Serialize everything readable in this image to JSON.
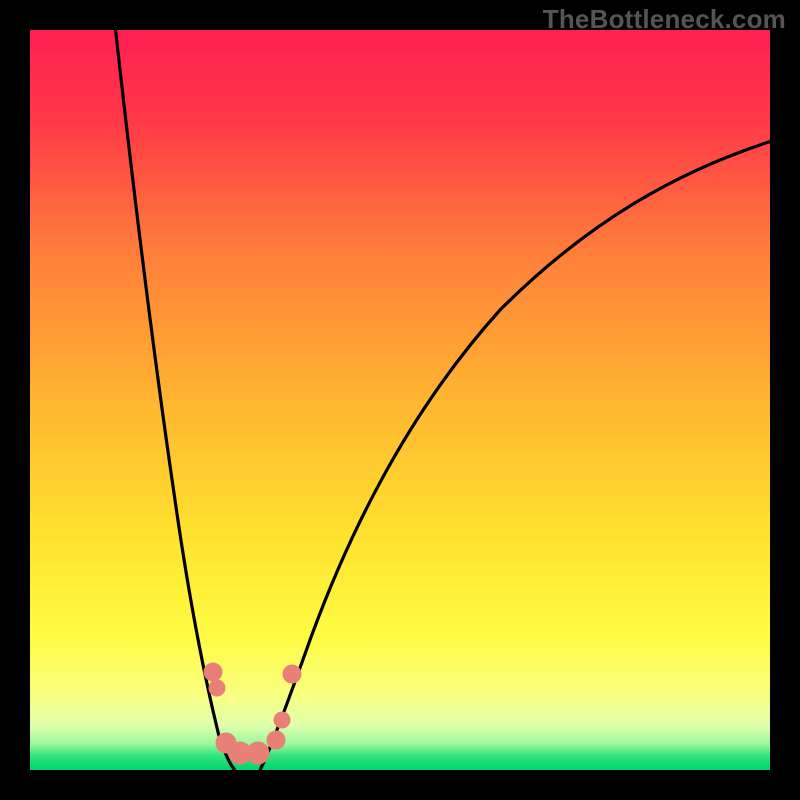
{
  "watermark": "TheBottleneck.com",
  "colors": {
    "frame": "#000000",
    "gradient_top": "#ff1f52",
    "gradient_mid": "#ffe12e",
    "gradient_bottom": "#00d56e",
    "curve": "#000000",
    "markers": "#e98077"
  },
  "chart_data": {
    "type": "line",
    "title": "",
    "xlabel": "",
    "ylabel": "",
    "xlim": [
      0,
      100
    ],
    "ylim": [
      0,
      100
    ],
    "grid": false,
    "legend": false,
    "annotations": [
      "TheBottleneck.com"
    ],
    "background_gradient": {
      "direction": "vertical",
      "stops": [
        {
          "pos": 0.0,
          "color": "#ff1f52"
        },
        {
          "pos": 0.3,
          "color": "#ff7e3a"
        },
        {
          "pos": 0.68,
          "color": "#ffe12e"
        },
        {
          "pos": 0.94,
          "color": "#dfffab"
        },
        {
          "pos": 1.0,
          "color": "#00d56e"
        }
      ]
    },
    "series": [
      {
        "name": "curve-left",
        "x": [
          11,
          13,
          16,
          20,
          22,
          24,
          26,
          27,
          28
        ],
        "y": [
          100,
          82,
          60,
          37,
          22,
          12,
          4,
          1,
          0
        ]
      },
      {
        "name": "curve-right",
        "x": [
          31,
          33,
          38,
          43,
          50,
          58,
          70,
          85,
          100
        ],
        "y": [
          0,
          3,
          18,
          33,
          49,
          62,
          75,
          82,
          85
        ]
      }
    ],
    "markers": {
      "name": "data-points",
      "color": "#e98077",
      "points": [
        {
          "x": 25,
          "y": 13
        },
        {
          "x": 25,
          "y": 11
        },
        {
          "x": 27,
          "y": 4
        },
        {
          "x": 28,
          "y": 2
        },
        {
          "x": 31,
          "y": 2
        },
        {
          "x": 33,
          "y": 4
        },
        {
          "x": 34,
          "y": 7
        },
        {
          "x": 35,
          "y": 13
        }
      ]
    }
  }
}
